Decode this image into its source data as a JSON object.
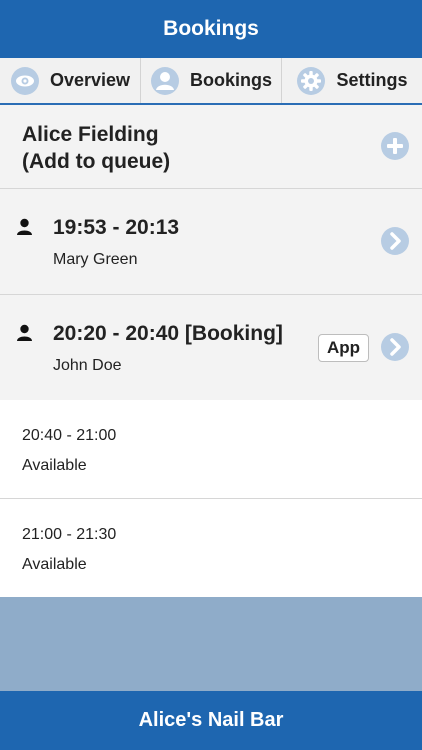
{
  "header": {
    "title": "Bookings"
  },
  "tabs": [
    {
      "label": "Overview",
      "icon": "eye-icon"
    },
    {
      "label": "Bookings",
      "icon": "user-icon"
    },
    {
      "label": "Settings",
      "icon": "gear-icon"
    }
  ],
  "queue": {
    "name": "Alice Fielding",
    "action": "(Add to queue)",
    "add_icon": "plus-circle-icon"
  },
  "bookings": [
    {
      "time": "19:53 - 20:13",
      "name": "Mary Green",
      "badge": null
    },
    {
      "time": "20:20 - 20:40 [Booking]",
      "name": "John Doe",
      "badge": "App"
    }
  ],
  "slots": [
    {
      "time": "20:40 - 21:00",
      "status": "Available"
    },
    {
      "time": "21:00 - 21:30",
      "status": "Available"
    }
  ],
  "footer": {
    "title": "Alice's Nail Bar"
  },
  "colors": {
    "brand_blue": "#1e66b0",
    "icon_light_blue": "#b7cce3",
    "filler": "#8facc9"
  }
}
